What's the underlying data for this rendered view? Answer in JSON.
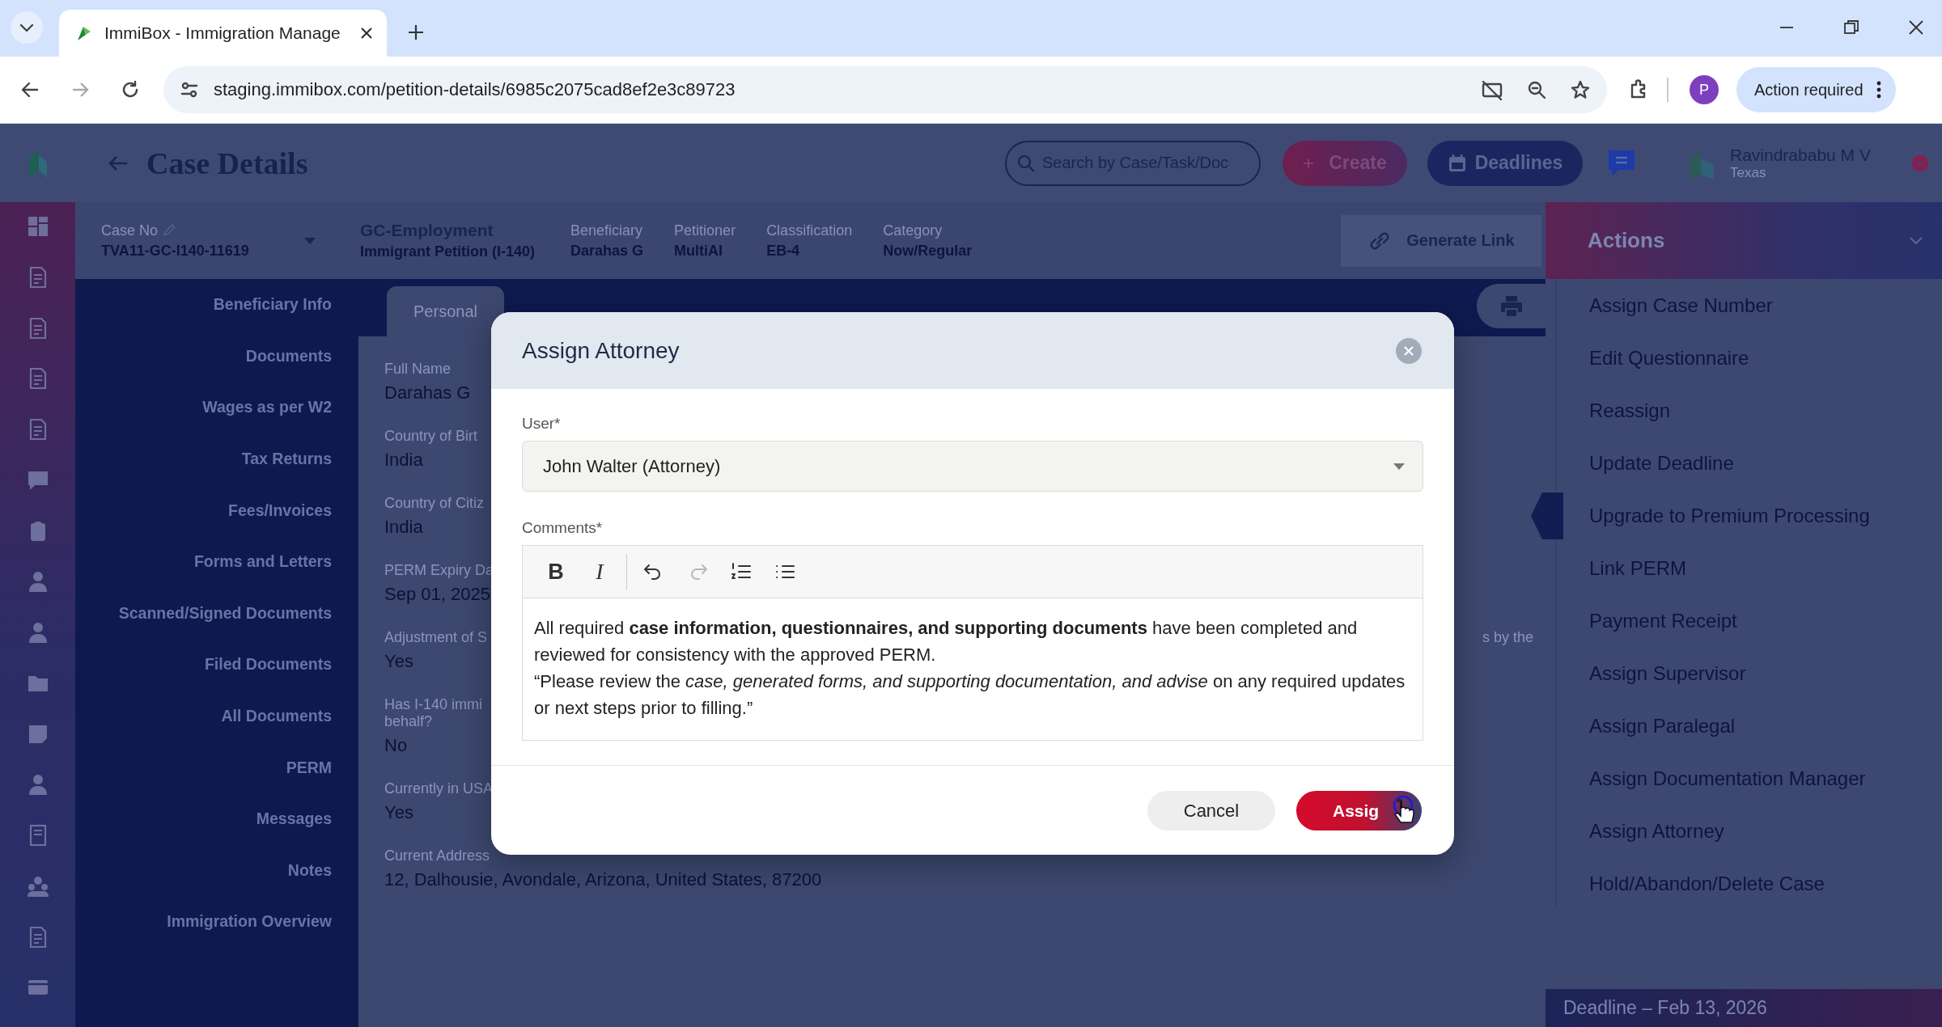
{
  "browser": {
    "tabs": [
      {
        "title": "ImmiBox - Immigration Manage",
        "selected": true
      }
    ],
    "url": "staging.immibox.com/petition-details/6985c2075cad8ef2e3c89723",
    "profile_initial": "P",
    "action_button": "Action required"
  },
  "header": {
    "title": "Case Details",
    "search_placeholder": "Search by Case/Task/Doc",
    "create_button": "Create",
    "deadlines_button": "Deadlines",
    "user": {
      "name": "Ravindrababu M V",
      "location": "Texas"
    }
  },
  "case_bar": {
    "case_no_label": "Case No",
    "case_no": "TVA11-GC-I140-11619",
    "type": "GC-Employment",
    "subtype": "Immigrant Petition (I-140)",
    "fields": [
      {
        "label": "Beneficiary",
        "value": "Darahas G"
      },
      {
        "label": "Petitioner",
        "value": "MultiAI"
      },
      {
        "label": "Classification",
        "value": "EB-4"
      },
      {
        "label": "Category",
        "value": "Now/Regular"
      }
    ],
    "generate_link": "Generate Link"
  },
  "sidebar": {
    "items": [
      "Beneficiary Info",
      "Documents",
      "Wages as per W2",
      "Tax Returns",
      "Fees/Invoices",
      "Forms and Letters",
      "Scanned/Signed Documents",
      "Filed Documents",
      "All Documents",
      "PERM",
      "Messages",
      "Notes",
      "Immigration Overview"
    ]
  },
  "content": {
    "tabs": [
      {
        "label": "Personal",
        "selected": true
      }
    ],
    "fields": [
      {
        "label": "Full Name",
        "value": "Darahas G"
      },
      {
        "label": "Country of Birt",
        "value": "India"
      },
      {
        "label": "Country of Citiz",
        "value": "India"
      },
      {
        "label": "PERM Expiry Da",
        "value": "Sep 01, 2025"
      },
      {
        "label": "Adjustment of S",
        "label_end": "s by the",
        "value": "Yes"
      },
      {
        "label": "Has I-140 immi\nbehalf?",
        "value": "No"
      },
      {
        "label": "Currently in USA",
        "value": "Yes"
      },
      {
        "label": "Current Address",
        "value": "12, Dalhousie, Avondale, Arizona, United States, 87200"
      }
    ]
  },
  "actions": {
    "title": "Actions",
    "items": [
      "Assign Case Number",
      "Edit Questionnaire",
      "Reassign",
      "Update Deadline",
      "Upgrade to Premium Processing",
      "Link PERM",
      "Payment Receipt",
      "Assign Supervisor",
      "Assign Paralegal",
      "Assign Documentation Manager",
      "Assign Attorney",
      "Hold/Abandon/Delete Case"
    ],
    "deadline": "Deadline – Feb 13, 2026"
  },
  "modal": {
    "title": "Assign Attorney",
    "user_label": "User*",
    "user_value": "John Walter (Attorney)",
    "comments_label": "Comments*",
    "toolbar": [
      {
        "kind": "bold",
        "label": "B",
        "disabled": false
      },
      {
        "kind": "italic",
        "label": "I",
        "disabled": false
      },
      {
        "kind": "undo",
        "disabled": false
      },
      {
        "kind": "redo",
        "disabled": true
      },
      {
        "kind": "ordered_list",
        "disabled": false
      },
      {
        "kind": "bullet_list",
        "disabled": false
      }
    ],
    "comment": [
      "All required **case information, questionnaires, and supporting documents** have been completed and reviewed for consistency with the approved PERM.",
      "“Please review the *case, generated forms, and supporting documentation, and advise* on any required updates or next steps prior to filling.”"
    ],
    "cancel_button": "Cancel",
    "assign_button": "Assig"
  }
}
